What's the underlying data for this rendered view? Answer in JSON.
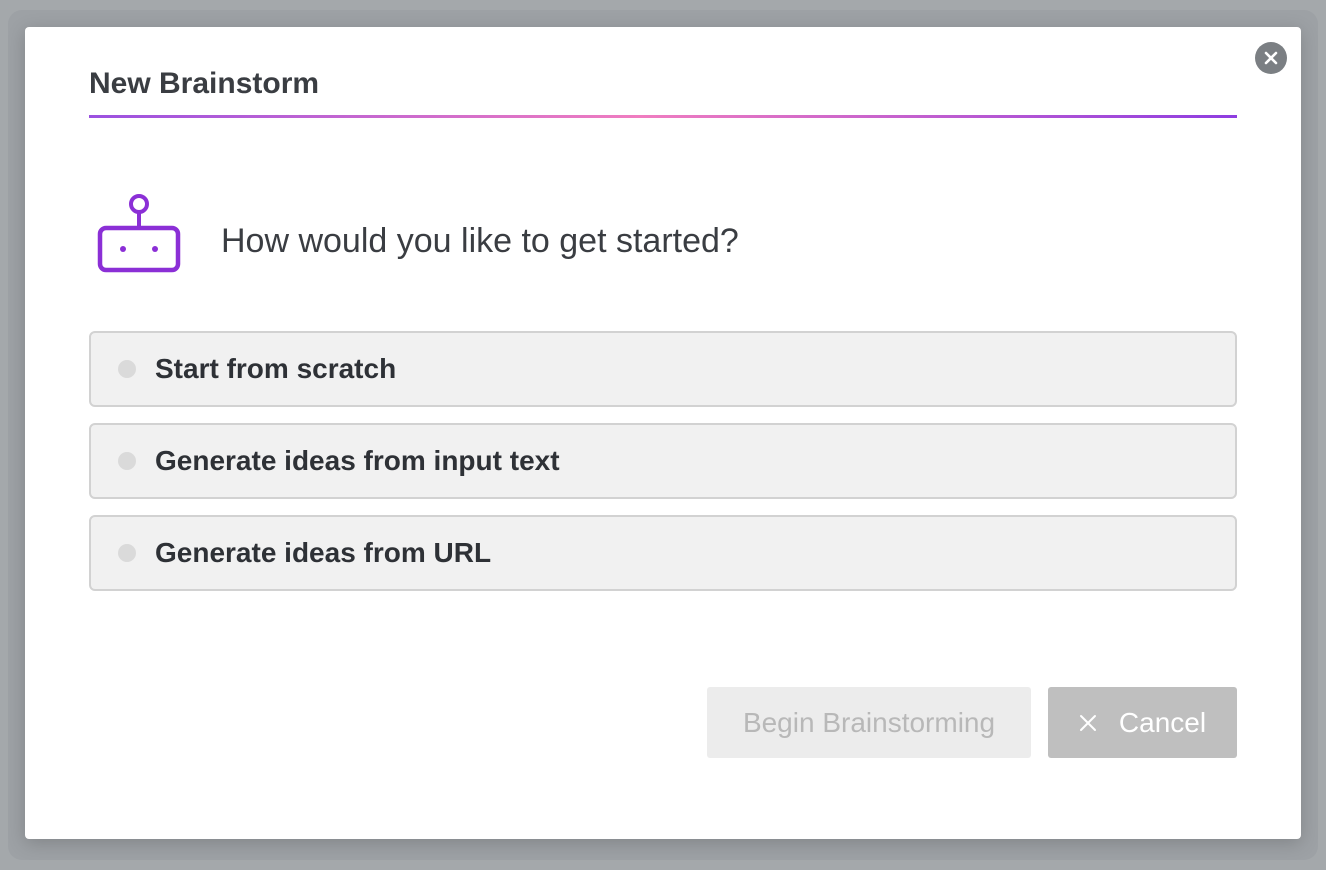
{
  "modal": {
    "title": "New Brainstorm",
    "prompt": "How would you like to get started?",
    "close_icon": "close-circle-icon",
    "header_icon": "robot-icon",
    "accent_gradient": [
      "#9b51e0",
      "#f07dc0",
      "#8e3de0"
    ],
    "icon_color": "#8b2fd6"
  },
  "options": [
    {
      "label": "Start from scratch",
      "selected": false
    },
    {
      "label": "Generate ideas from input text",
      "selected": false
    },
    {
      "label": "Generate ideas from URL",
      "selected": false
    }
  ],
  "footer": {
    "begin_label": "Begin Brainstorming",
    "begin_disabled": true,
    "cancel_label": "Cancel",
    "cancel_icon": "close-icon"
  }
}
